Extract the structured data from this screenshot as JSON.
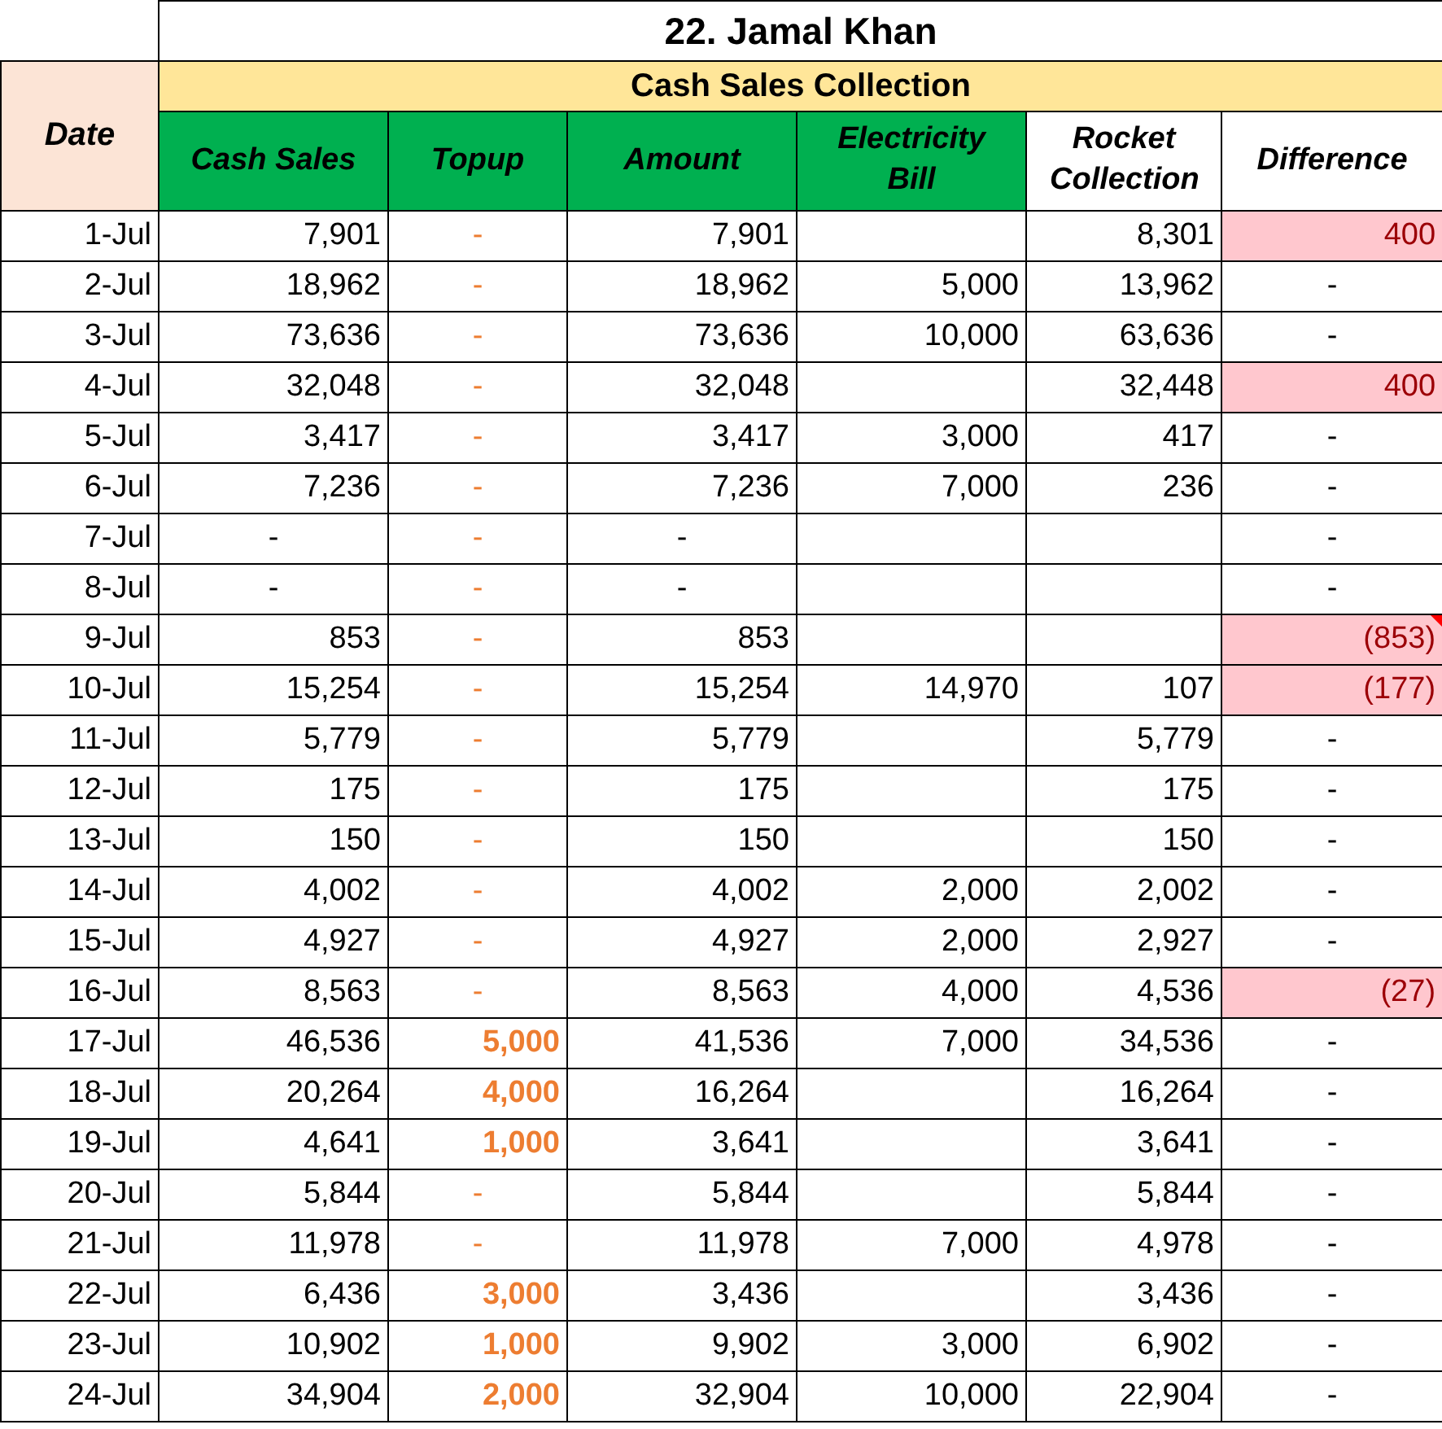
{
  "title": "22. Jamal Khan",
  "date_header": "Date",
  "group_header": "Cash Sales Collection",
  "columns": [
    {
      "label": "Cash Sales",
      "kind": "green"
    },
    {
      "label": "Topup",
      "kind": "green"
    },
    {
      "label": "Amount",
      "kind": "green"
    },
    {
      "label": "Electricity Bill",
      "kind": "green"
    },
    {
      "label": "Rocket Collection",
      "kind": "plain"
    },
    {
      "label": "Difference",
      "kind": "plain"
    }
  ],
  "rows": [
    {
      "date": "1-Jul",
      "cash_sales": "7,901",
      "topup": "-",
      "topup_highlight": false,
      "total": "7,901",
      "rocket": "8,301",
      "difference": "400",
      "flagged": true,
      "comment": false
    },
    {
      "date": "2-Jul",
      "cash_sales": "18,962",
      "topup": "-",
      "topup_highlight": false,
      "total": "18,962",
      "electricity": "5,000",
      "rocket": "13,962",
      "difference": "-",
      "flagged": false,
      "comment": false
    },
    {
      "date": "3-Jul",
      "cash_sales": "73,636",
      "topup": "-",
      "topup_highlight": false,
      "total": "73,636",
      "electricity": "10,000",
      "rocket": "63,636",
      "difference": "-",
      "flagged": false,
      "comment": false
    },
    {
      "date": "4-Jul",
      "cash_sales": "32,048",
      "topup": "-",
      "topup_highlight": false,
      "total": "32,048",
      "rocket": "32,448",
      "difference": "400",
      "flagged": true,
      "comment": false
    },
    {
      "date": "5-Jul",
      "cash_sales": "3,417",
      "topup": "-",
      "topup_highlight": false,
      "total": "3,417",
      "electricity": "3,000",
      "rocket": "417",
      "difference": "-",
      "flagged": false,
      "comment": false
    },
    {
      "date": "6-Jul",
      "cash_sales": "7,236",
      "topup": "-",
      "topup_highlight": false,
      "total": "7,236",
      "electricity": "7,000",
      "rocket": "236",
      "difference": "-",
      "flagged": false,
      "comment": false
    },
    {
      "date": "7-Jul",
      "cash_sales": "-",
      "topup": "-",
      "topup_highlight": false,
      "total": "-",
      "difference": "-",
      "flagged": false,
      "comment": false
    },
    {
      "date": "8-Jul",
      "cash_sales": "-",
      "topup": "-",
      "topup_highlight": false,
      "total": "-",
      "difference": "-",
      "flagged": false,
      "comment": false
    },
    {
      "date": "9-Jul",
      "cash_sales": "853",
      "topup": "-",
      "topup_highlight": false,
      "total": "853",
      "difference": "(853)",
      "flagged": true,
      "comment": true
    },
    {
      "date": "10-Jul",
      "cash_sales": "15,254",
      "topup": "-",
      "topup_highlight": false,
      "total": "15,254",
      "electricity": "14,970",
      "rocket": "107",
      "difference": "(177)",
      "flagged": true,
      "comment": false
    },
    {
      "date": "11-Jul",
      "cash_sales": "5,779",
      "topup": "-",
      "topup_highlight": false,
      "total": "5,779",
      "rocket": "5,779",
      "difference": "-",
      "flagged": false,
      "comment": false
    },
    {
      "date": "12-Jul",
      "cash_sales": "175",
      "topup": "-",
      "topup_highlight": false,
      "total": "175",
      "rocket": "175",
      "difference": "-",
      "flagged": false,
      "comment": false
    },
    {
      "date": "13-Jul",
      "cash_sales": "150",
      "topup": "-",
      "topup_highlight": false,
      "total": "150",
      "rocket": "150",
      "difference": "-",
      "flagged": false,
      "comment": false
    },
    {
      "date": "14-Jul",
      "cash_sales": "4,002",
      "topup": "-",
      "topup_highlight": false,
      "total": "4,002",
      "electricity": "2,000",
      "rocket": "2,002",
      "difference": "-",
      "flagged": false,
      "comment": false
    },
    {
      "date": "15-Jul",
      "cash_sales": "4,927",
      "topup": "-",
      "topup_highlight": false,
      "total": "4,927",
      "electricity": "2,000",
      "rocket": "2,927",
      "difference": "-",
      "flagged": false,
      "comment": false
    },
    {
      "date": "16-Jul",
      "cash_sales": "8,563",
      "topup": "-",
      "topup_highlight": false,
      "total": "8,563",
      "electricity": "4,000",
      "rocket": "4,536",
      "difference": "(27)",
      "flagged": true,
      "comment": false
    },
    {
      "date": "17-Jul",
      "cash_sales": "46,536",
      "topup": "5,000",
      "topup_highlight": true,
      "total": "41,536",
      "electricity": "7,000",
      "rocket": "34,536",
      "difference": "-",
      "flagged": false,
      "comment": false
    },
    {
      "date": "18-Jul",
      "cash_sales": "20,264",
      "topup": "4,000",
      "topup_highlight": true,
      "total": "16,264",
      "rocket": "16,264",
      "difference": "-",
      "flagged": false,
      "comment": false
    },
    {
      "date": "19-Jul",
      "cash_sales": "4,641",
      "topup": "1,000",
      "topup_highlight": true,
      "total": "3,641",
      "rocket": "3,641",
      "difference": "-",
      "flagged": false,
      "comment": false
    },
    {
      "date": "20-Jul",
      "cash_sales": "5,844",
      "topup": "-",
      "topup_highlight": false,
      "total": "5,844",
      "rocket": "5,844",
      "difference": "-",
      "flagged": false,
      "comment": false
    },
    {
      "date": "21-Jul",
      "cash_sales": "11,978",
      "topup": "-",
      "topup_highlight": false,
      "total": "11,978",
      "electricity": "7,000",
      "rocket": "4,978",
      "difference": "-",
      "flagged": false,
      "comment": false
    },
    {
      "date": "22-Jul",
      "cash_sales": "6,436",
      "topup": "3,000",
      "topup_highlight": true,
      "total": "3,436",
      "rocket": "3,436",
      "difference": "-",
      "flagged": false,
      "comment": false
    },
    {
      "date": "23-Jul",
      "cash_sales": "10,902",
      "topup": "1,000",
      "topup_highlight": true,
      "total": "9,902",
      "electricity": "3,000",
      "rocket": "6,902",
      "difference": "-",
      "flagged": false,
      "comment": false
    },
    {
      "date": "24-Jul",
      "cash_sales": "34,904",
      "topup": "2,000",
      "topup_highlight": true,
      "total": "32,904",
      "electricity": "10,000",
      "rocket": "22,904",
      "difference": "-",
      "flagged": false,
      "comment": false
    }
  ]
}
